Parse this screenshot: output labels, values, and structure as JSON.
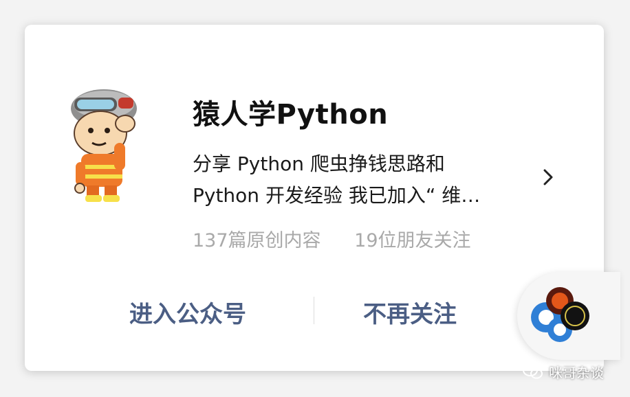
{
  "account": {
    "name": "猿人学Python",
    "description_line1": "分享 Python 爬虫挣钱思路和",
    "description_line2": "Python 开发经验 我已加入“ 维…",
    "articles": "137篇原创内容",
    "followers": "19位朋友关注"
  },
  "actions": {
    "enter": "进入公众号",
    "unfollow": "不再关注"
  },
  "watermark": {
    "text": "咪哥杂谈"
  },
  "icons": {
    "avatar": "cartoon-firefighter-avatar",
    "chevron": "chevron-right-icon",
    "float": "floating-audio-widget-icon",
    "wechat": "wechat-icon"
  },
  "colors": {
    "action_text": "#4b5e84",
    "stats_text": "#a9a9a9",
    "title_text": "#111111"
  }
}
